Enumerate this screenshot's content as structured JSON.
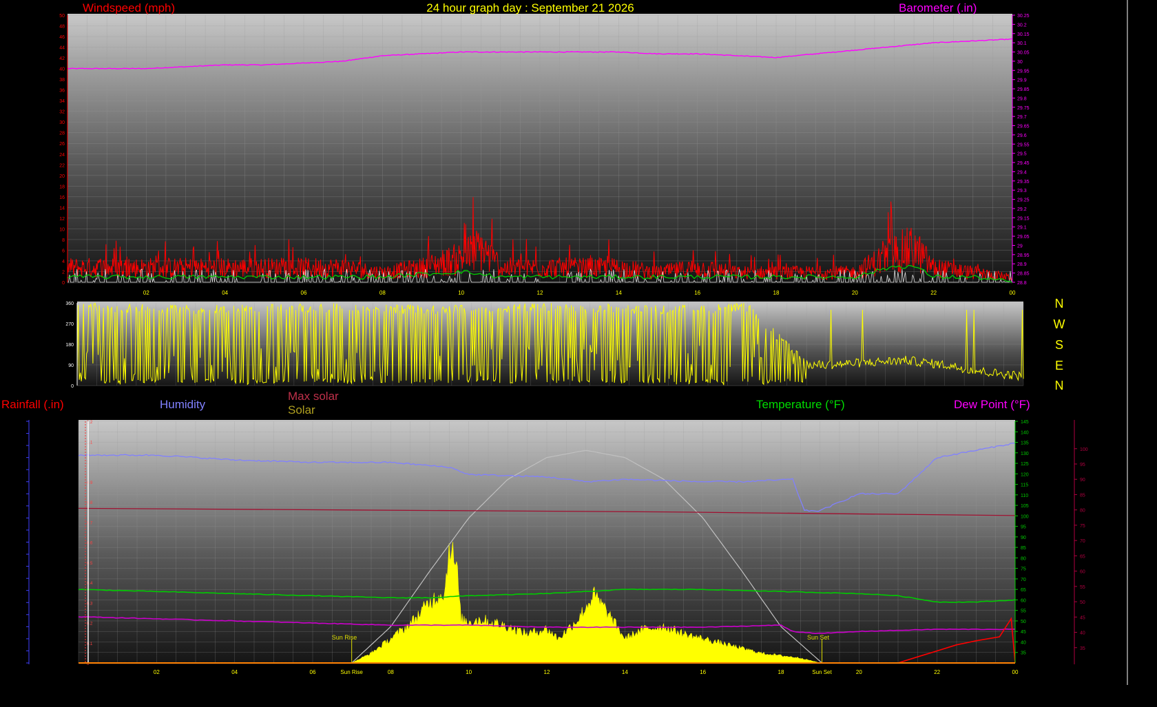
{
  "title": "24 hour graph day : September 21 2026",
  "colors": {
    "background": "#000000",
    "windspeed": "#ff0000",
    "gust": "#ffffff",
    "wind_avg": "#00cc00",
    "barometer": "#ff00ff",
    "direction": "#ffff00",
    "humidity": "#8080ff",
    "max_solar": "#c0c0c0",
    "solar": "#ffff00",
    "temperature": "#00cc00",
    "dew_point": "#cc00cc",
    "rainfall": "#ff0000",
    "rain_axis": "#4040ff",
    "dew_axis": "#b00040"
  },
  "compass": [
    "N",
    "W",
    "S",
    "E",
    "N"
  ],
  "sun": {
    "rise_label": "Sun Rise",
    "set_label": "Sun Set",
    "rise_hour": 7.0,
    "set_hour": 19.05
  },
  "chart_data": [
    {
      "type": "line",
      "id": "wind_baro",
      "title": "24 hour graph day : September 21 2026",
      "left_label": "Windspeed (mph)",
      "right_label": "Barometer (.in)",
      "x_ticks": [
        "02",
        "04",
        "06",
        "08",
        "10",
        "12",
        "14",
        "16",
        "18",
        "20",
        "22",
        "00"
      ],
      "xlim": [
        0,
        24
      ],
      "ylim_left": [
        0,
        50
      ],
      "ylim_right": [
        28.8,
        30.25
      ],
      "y_ticks_left": [
        "0",
        "2",
        "4",
        "6",
        "8",
        "10",
        "12",
        "14",
        "16",
        "18",
        "20",
        "22",
        "24",
        "26",
        "28",
        "30",
        "32",
        "34",
        "36",
        "38",
        "40",
        "42",
        "44",
        "46",
        "48",
        "50"
      ],
      "y_ticks_right": [
        "28.8",
        "28.85",
        "28.9",
        "28.95",
        "29",
        "29.05",
        "29.1",
        "29.15",
        "29.2",
        "29.25",
        "29.3",
        "29.35",
        "29.4",
        "29.45",
        "29.5",
        "29.55",
        "29.6",
        "29.65",
        "29.7",
        "29.75",
        "29.8",
        "29.85",
        "29.9",
        "29.95",
        "30",
        "30.05",
        "30.1",
        "30.15",
        "30.2",
        "30.25"
      ],
      "grid": true,
      "series": [
        {
          "name": "Barometer (.in)",
          "axis": "right",
          "x": [
            0,
            1,
            2,
            3,
            4,
            5,
            6,
            7,
            8,
            9,
            10,
            11,
            12,
            13,
            14,
            15,
            16,
            17,
            18,
            19,
            20,
            21,
            22,
            23,
            24
          ],
          "y": [
            29.96,
            29.96,
            29.96,
            29.97,
            29.98,
            29.98,
            29.99,
            30.0,
            30.03,
            30.04,
            30.05,
            30.05,
            30.05,
            30.05,
            30.05,
            30.04,
            30.04,
            30.03,
            30.02,
            30.04,
            30.06,
            30.08,
            30.1,
            30.11,
            30.12
          ]
        },
        {
          "name": "Windspeed (mph)",
          "axis": "left",
          "x": [
            0,
            1,
            2,
            3,
            4,
            5,
            6,
            7,
            8,
            9,
            10,
            10.5,
            11,
            12,
            13,
            14,
            15,
            16,
            17,
            18,
            19,
            20,
            21,
            21.5,
            22,
            23,
            24
          ],
          "y": [
            3,
            3,
            3,
            3,
            3,
            3,
            3,
            3,
            2,
            3,
            5,
            7,
            3,
            3,
            3,
            3,
            2,
            3,
            2,
            2,
            2,
            2,
            6,
            7,
            3,
            2,
            1
          ]
        },
        {
          "name": "Wind average",
          "axis": "left",
          "x": [
            0,
            2,
            4,
            6,
            8,
            10,
            11,
            12,
            13,
            14,
            16,
            18,
            20,
            21,
            21.5,
            22,
            23,
            24
          ],
          "y": [
            1,
            1,
            1,
            1,
            1,
            2,
            1,
            1,
            1,
            1,
            1,
            1,
            1,
            3,
            3,
            1,
            1,
            0
          ]
        }
      ]
    },
    {
      "type": "line",
      "id": "direction",
      "y_ticks": [
        "0",
        "90",
        "180",
        "270",
        "360"
      ],
      "ylim": [
        0,
        360
      ],
      "xlim": [
        0,
        24
      ],
      "grid": true,
      "series": [
        {
          "name": "Wind direction",
          "x": [
            0,
            3,
            6,
            9,
            12,
            15,
            17,
            18.5,
            19,
            20,
            21,
            22,
            23,
            24
          ],
          "y": [
            340,
            330,
            340,
            330,
            340,
            330,
            340,
            90,
            90,
            100,
            110,
            90,
            60,
            40
          ]
        }
      ]
    },
    {
      "type": "area",
      "id": "temp_solar",
      "left_label": "Rainfall (.in)",
      "labels": {
        "humidity": "Humidity",
        "max_solar": "Max solar",
        "solar": "Solar",
        "temperature": "Temperature (°F)",
        "dew_point": "Dew Point (°F)"
      },
      "x_ticks": [
        "02",
        "04",
        "06",
        "Sun Rise",
        "08",
        "10",
        "12",
        "14",
        "16",
        "18",
        "Sun Set",
        "20",
        "22",
        "00"
      ],
      "xlim": [
        0,
        24
      ],
      "ylim_humidity": [
        0,
        100
      ],
      "ylim_temperature": [
        30,
        145
      ],
      "ylim_dew": [
        30,
        105
      ],
      "ylim_rain": [
        0,
        1.2
      ],
      "y_ticks_temperature": [
        "35",
        "40",
        "45",
        "50",
        "55",
        "60",
        "65",
        "70",
        "75",
        "80",
        "85",
        "90",
        "95",
        "100",
        "105",
        "110",
        "115",
        "120",
        "125",
        "130",
        "135",
        "140",
        "145"
      ],
      "y_ticks_dew": [
        "35",
        "40",
        "45",
        "50",
        "55",
        "60",
        "65",
        "70",
        "75",
        "80",
        "85",
        "90",
        "95",
        "100"
      ],
      "y_ticks_rain": [
        "0",
        "0.1",
        "0.2",
        "0.3",
        "0.4",
        "0.5",
        "0.6",
        "0.7",
        "0.8",
        "0.9",
        "1",
        "1.1",
        "1.2"
      ],
      "grid": true,
      "series": [
        {
          "name": "Humidity",
          "x": [
            0,
            2,
            4,
            6,
            8,
            9.5,
            10,
            12,
            13,
            14,
            16,
            17,
            18.3,
            18.6,
            19,
            20,
            21,
            22,
            23,
            24
          ],
          "y": [
            86,
            86,
            84,
            83,
            83,
            81,
            78,
            77,
            75,
            76,
            75,
            75,
            76,
            63,
            63,
            70,
            70,
            85,
            88,
            91
          ]
        },
        {
          "name": "Max solar",
          "x": [
            7.0,
            8,
            9,
            10,
            11,
            12,
            13,
            14,
            15,
            16,
            17,
            18,
            19.05
          ],
          "y": [
            0,
            15,
            38,
            60,
            76,
            85,
            88,
            85,
            76,
            60,
            38,
            15,
            0
          ]
        },
        {
          "name": "Solar",
          "x": [
            7,
            7.5,
            8,
            8.5,
            9,
            9.4,
            9.5,
            9.7,
            9.8,
            10,
            10.3,
            11,
            11.5,
            12,
            12.3,
            12.8,
            13.2,
            13.5,
            14,
            14.5,
            15,
            15.5,
            16,
            16.5,
            17,
            17.5,
            18,
            18.5,
            19
          ],
          "y": [
            0,
            4,
            10,
            16,
            25,
            30,
            50,
            38,
            18,
            17,
            18,
            15,
            12,
            14,
            10,
            18,
            28,
            22,
            10,
            14,
            15,
            12,
            10,
            8,
            6,
            4,
            3,
            2,
            0
          ]
        },
        {
          "name": "Temperature (°F)",
          "x": [
            0,
            2,
            4,
            6,
            8,
            9,
            10,
            12,
            13,
            14,
            16,
            18,
            20,
            21,
            22,
            23,
            24
          ],
          "y": [
            65,
            64,
            63,
            62,
            61,
            61,
            62,
            63,
            64,
            65,
            65,
            64,
            63,
            62,
            59,
            59,
            60
          ]
        },
        {
          "name": "Dew Point (°F)",
          "x": [
            0,
            2,
            4,
            6,
            8,
            10,
            12,
            14,
            16,
            18,
            18.3,
            19,
            20,
            22,
            24
          ],
          "y": [
            52,
            51,
            50,
            49,
            48,
            48,
            47,
            47,
            47,
            48,
            45,
            44,
            45,
            46,
            46
          ]
        },
        {
          "name": "Rainfall (.in)",
          "x": [
            0,
            21,
            21.5,
            22,
            22.5,
            23,
            23.6,
            23.7,
            23.9,
            24
          ],
          "y": [
            0,
            0,
            0.03,
            0.06,
            0.09,
            0.11,
            0.13,
            0.16,
            0.22,
            0
          ]
        }
      ]
    }
  ]
}
